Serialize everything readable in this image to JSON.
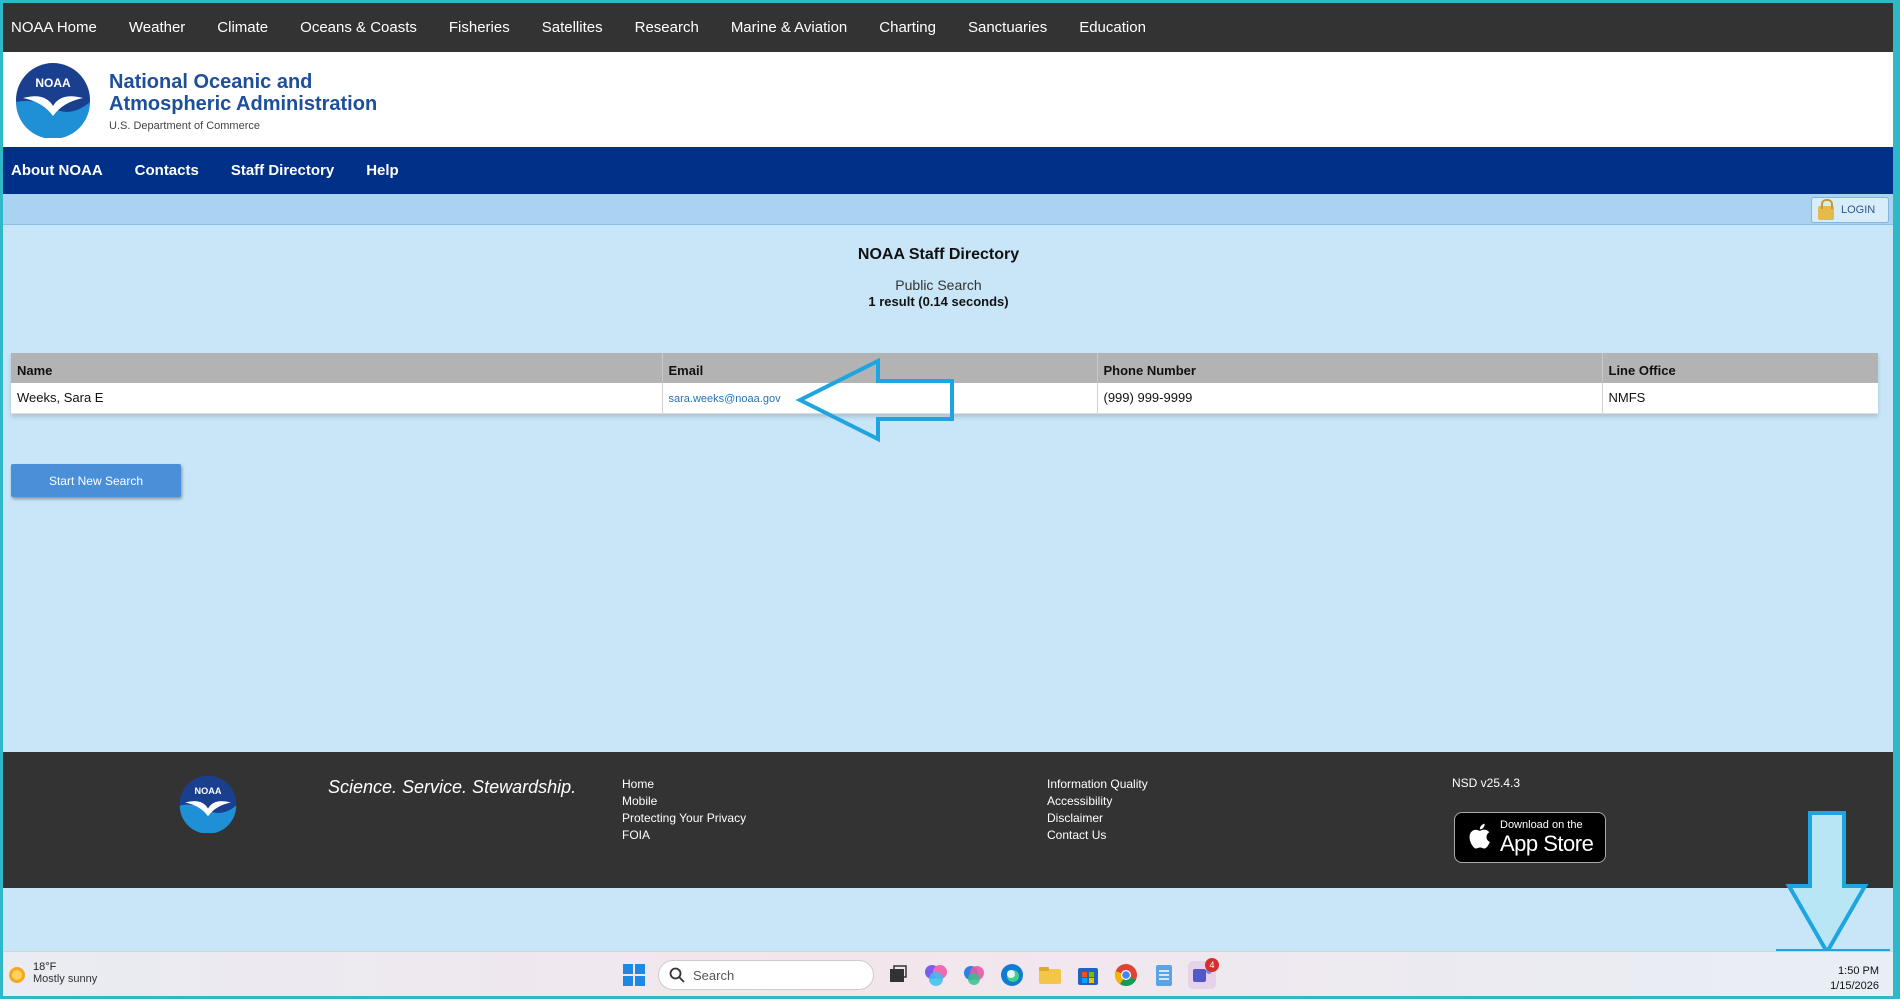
{
  "topnav": {
    "items": [
      "NOAA Home",
      "Weather",
      "Climate",
      "Oceans & Coasts",
      "Fisheries",
      "Satellites",
      "Research",
      "Marine & Aviation",
      "Charting",
      "Sanctuaries",
      "Education"
    ]
  },
  "header": {
    "logo_text": "NOAA",
    "org_line1": "National Oceanic and",
    "org_line2": "Atmospheric Administration",
    "org_sub": "U.S. Department of Commerce"
  },
  "bluenav": {
    "items": [
      "About NOAA",
      "Contacts",
      "Staff Directory",
      "Help"
    ]
  },
  "login": {
    "label": "LOGIN",
    "icon": "lock-icon"
  },
  "main": {
    "title": "NOAA Staff Directory",
    "subtitle": "Public Search",
    "result_summary": "1 result (0.14 seconds)",
    "table": {
      "headers": [
        "Name",
        "Email",
        "Phone Number",
        "Line Office"
      ],
      "rows": [
        {
          "name": "Weeks, Sara E",
          "email": "sara.weeks@noaa.gov",
          "phone": "(999) 999-9999",
          "office": "NMFS"
        }
      ]
    },
    "new_search_label": "Start New Search"
  },
  "footer": {
    "logo_text": "NOAA",
    "tagline": "Science. Service. Stewardship.",
    "links_col1": [
      "Home",
      "Mobile",
      "Protecting Your Privacy",
      "FOIA"
    ],
    "links_col2": [
      "Information Quality",
      "Accessibility",
      "Disclaimer",
      "Contact Us"
    ],
    "version": "NSD v25.4.3",
    "appstore_small": "Download on the",
    "appstore_big": "App Store"
  },
  "taskbar": {
    "temp": "18°F",
    "condition": "Mostly sunny",
    "search_placeholder": "Search",
    "time": "1:50 PM",
    "date": "1/15/2026",
    "teams_badge": "4"
  },
  "colors": {
    "topnav_bg": "#333333",
    "bluenav_bg": "#003087",
    "content_bg": "#c8e6f8",
    "annotation": "#1ea5e0",
    "button": "#4a90d9"
  }
}
